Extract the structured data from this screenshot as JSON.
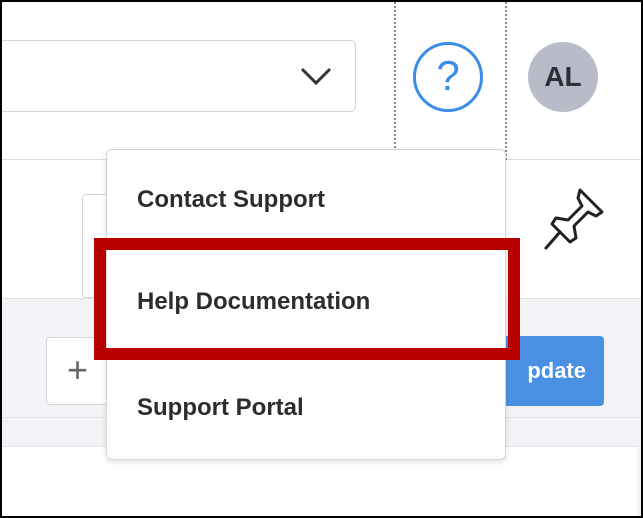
{
  "header": {
    "help_icon_glyph": "?",
    "avatar_initials": "AL"
  },
  "toolbar": {
    "plus_glyph": "+",
    "update_label": "pdate"
  },
  "help_menu": {
    "items": [
      {
        "label": "Contact Support"
      },
      {
        "label": "Help Documentation"
      },
      {
        "label": "Support Portal"
      }
    ],
    "highlighted_item": "Help Documentation"
  },
  "colors": {
    "accent": "#3b8ee8",
    "button_primary": "#4a90e2",
    "highlight": "#b80000",
    "avatar_bg": "#b7bcc8"
  },
  "icons": [
    "chevron-down-icon",
    "help-icon",
    "pin-icon",
    "plus-icon"
  ]
}
